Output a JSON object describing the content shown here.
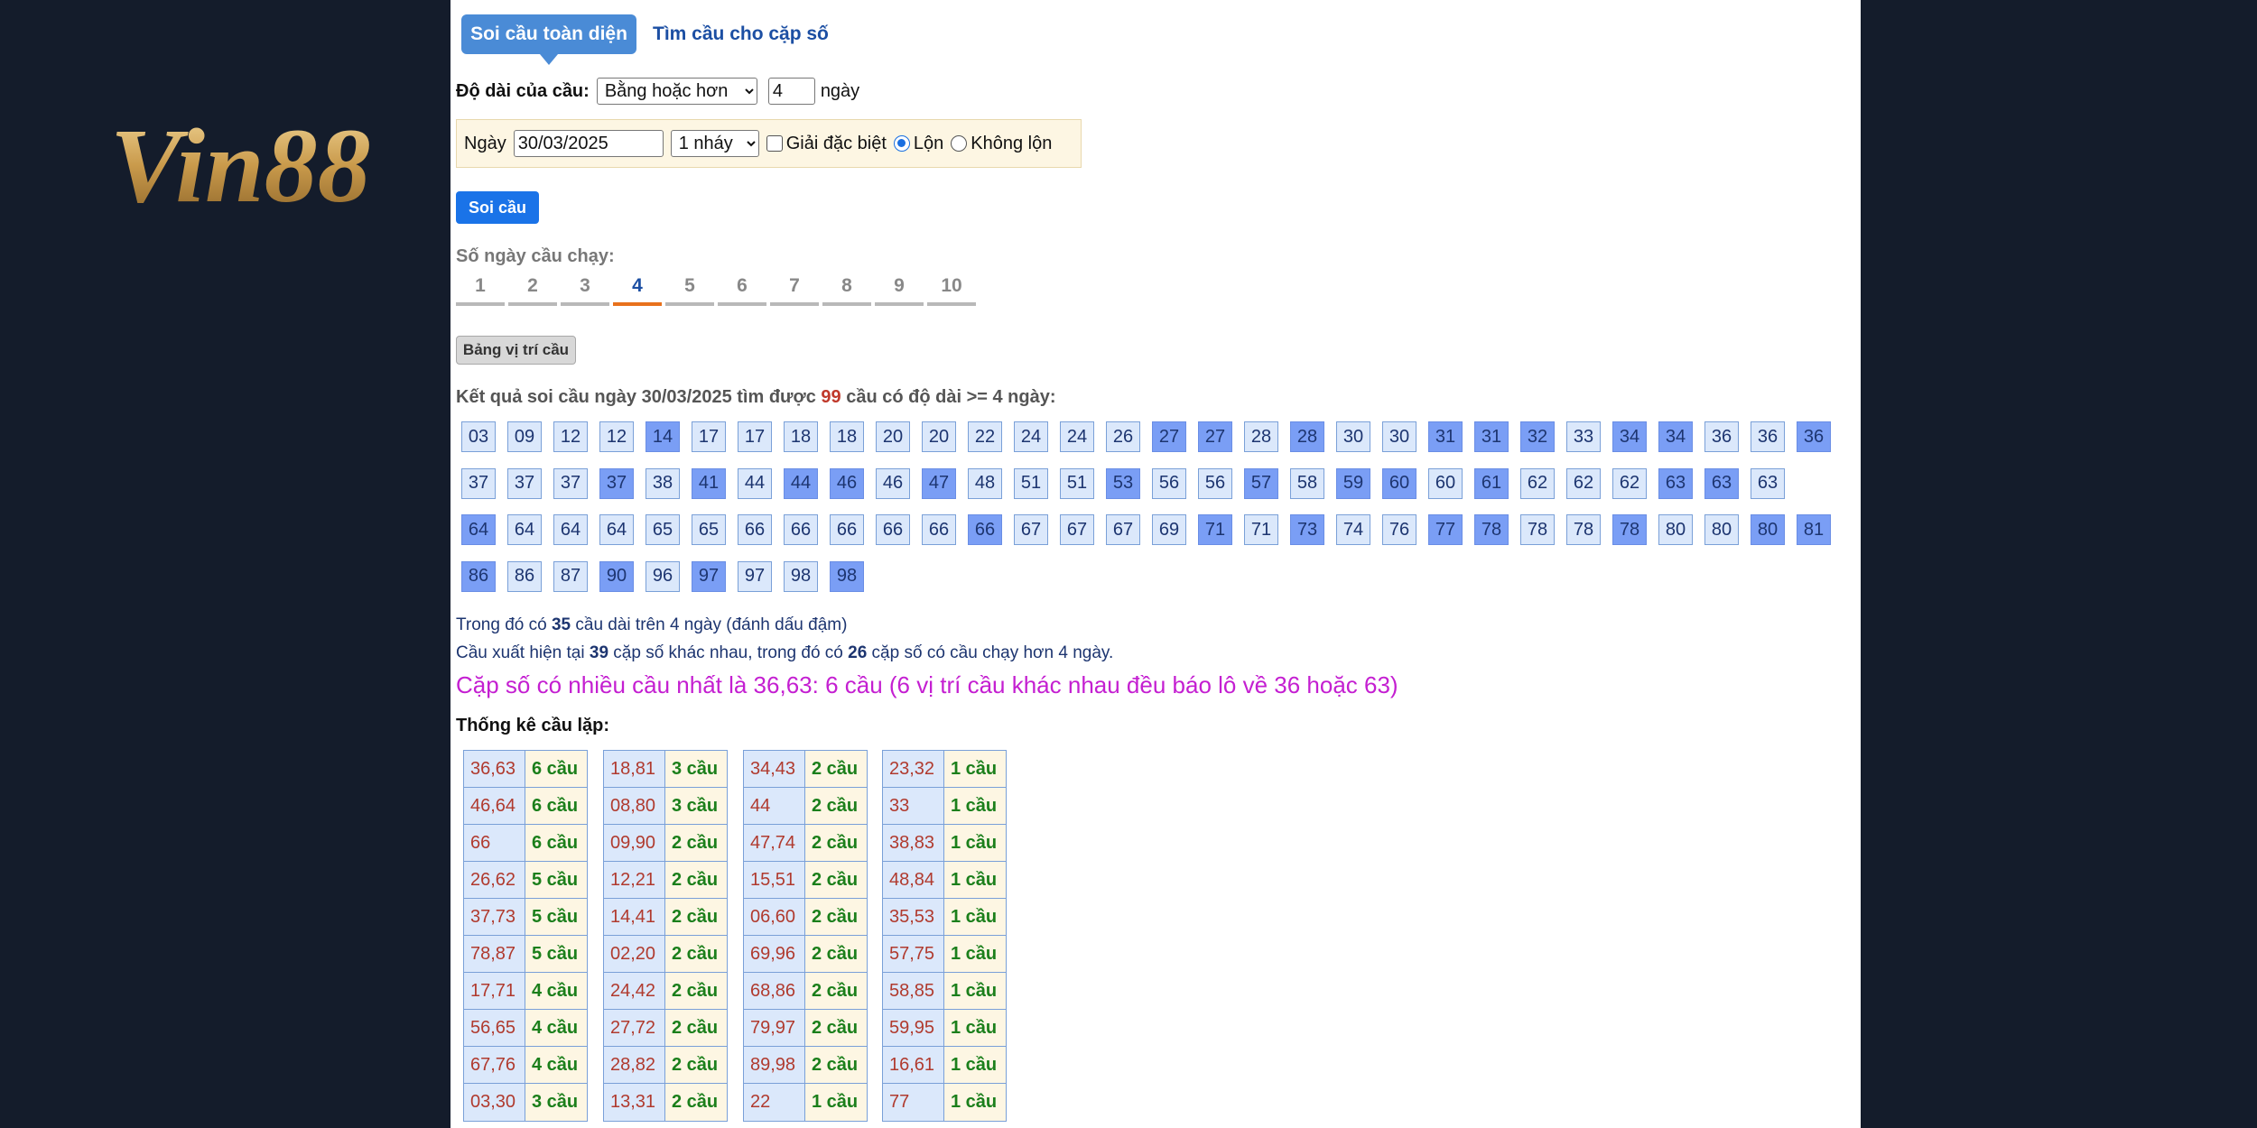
{
  "logo": {
    "text": "Vin88"
  },
  "tabs": {
    "active": "Soi cầu toàn diện",
    "other": "Tìm cầu cho cặp số"
  },
  "length": {
    "label": "Độ dài của cầu:",
    "mode": "Bằng hoặc hơn",
    "value": "4",
    "unit": "ngày"
  },
  "filter": {
    "date_label": "Ngày",
    "date": "30/03/2025",
    "nhay": "1 nháy",
    "special": "Giải đặc biệt",
    "lon": "Lộn",
    "khong_lon": "Không lộn"
  },
  "button_soi": "Soi cầu",
  "days": {
    "label": "Số ngày cầu chạy:",
    "items": [
      "1",
      "2",
      "3",
      "4",
      "5",
      "6",
      "7",
      "8",
      "9",
      "10"
    ],
    "active": "4"
  },
  "button_bang": "Bảng vị trí cầu",
  "result": {
    "prefix": "Kết quả soi cầu ngày 30/03/2025 tìm được ",
    "count": "99",
    "suffix": " cầu có độ dài >= 4 ngày:"
  },
  "numbers": [
    [
      "03",
      0
    ],
    [
      "09",
      0
    ],
    [
      "12",
      0
    ],
    [
      "12",
      0
    ],
    [
      "14",
      1
    ],
    [
      "17",
      0
    ],
    [
      "17",
      0
    ],
    [
      "18",
      0
    ],
    [
      "18",
      0
    ],
    [
      "20",
      0
    ],
    [
      "20",
      0
    ],
    [
      "22",
      0
    ],
    [
      "24",
      0
    ],
    [
      "24",
      0
    ],
    [
      "26",
      0
    ],
    [
      "27",
      1
    ],
    [
      "27",
      1
    ],
    [
      "28",
      0
    ],
    [
      "28",
      1
    ],
    [
      "30",
      0
    ],
    [
      "30",
      0
    ],
    [
      "31",
      1
    ],
    [
      "31",
      1
    ],
    [
      "32",
      1
    ],
    [
      "33",
      0
    ],
    [
      "34",
      1
    ],
    [
      "34",
      1
    ],
    [
      "36",
      0
    ],
    [
      "36",
      0
    ],
    [
      "36",
      1
    ],
    [
      "37",
      0
    ],
    [
      "37",
      0
    ],
    [
      "37",
      0
    ],
    [
      "37",
      1
    ],
    [
      "38",
      0
    ],
    [
      "41",
      1
    ],
    [
      "44",
      0
    ],
    [
      "44",
      1
    ],
    [
      "46",
      1
    ],
    [
      "46",
      0
    ],
    [
      "47",
      1
    ],
    [
      "48",
      0
    ],
    [
      "51",
      0
    ],
    [
      "51",
      0
    ],
    [
      "53",
      1
    ],
    [
      "56",
      0
    ],
    [
      "56",
      0
    ],
    [
      "57",
      1
    ],
    [
      "58",
      0
    ],
    [
      "59",
      1
    ],
    [
      "60",
      1
    ],
    [
      "60",
      0
    ],
    [
      "61",
      1
    ],
    [
      "62",
      0
    ],
    [
      "62",
      0
    ],
    [
      "62",
      0
    ],
    [
      "63",
      1
    ],
    [
      "63",
      1
    ],
    [
      "63",
      0
    ],
    [
      "64",
      1
    ],
    [
      "64",
      0
    ],
    [
      "64",
      0
    ],
    [
      "64",
      0
    ],
    [
      "65",
      0
    ],
    [
      "65",
      0
    ],
    [
      "66",
      0
    ],
    [
      "66",
      0
    ],
    [
      "66",
      0
    ],
    [
      "66",
      0
    ],
    [
      "66",
      0
    ],
    [
      "66",
      1
    ],
    [
      "67",
      0
    ],
    [
      "67",
      0
    ],
    [
      "67",
      0
    ],
    [
      "69",
      0
    ],
    [
      "71",
      1
    ],
    [
      "71",
      0
    ],
    [
      "73",
      1
    ],
    [
      "74",
      0
    ],
    [
      "76",
      0
    ],
    [
      "77",
      1
    ],
    [
      "78",
      1
    ],
    [
      "78",
      0
    ],
    [
      "78",
      0
    ],
    [
      "78",
      1
    ],
    [
      "80",
      0
    ],
    [
      "80",
      0
    ],
    [
      "80",
      1
    ],
    [
      "81",
      1
    ],
    [
      "86",
      1
    ],
    [
      "86",
      0
    ],
    [
      "87",
      0
    ],
    [
      "90",
      1
    ],
    [
      "96",
      0
    ],
    [
      "97",
      1
    ],
    [
      "97",
      0
    ],
    [
      "98",
      0
    ],
    [
      "98",
      1
    ]
  ],
  "info": {
    "line1_a": "Trong đó có ",
    "line1_n": "35",
    "line1_b": " cầu dài trên 4 ngày (đánh dấu đậm)",
    "line2_a": "Cầu xuất hiện tại ",
    "line2_n1": "39",
    "line2_b": " cặp số khác nhau, trong đó có ",
    "line2_n2": "26",
    "line2_c": " cặp số có cầu chạy hơn 4 ngày."
  },
  "best": "Cặp số có nhiều cầu nhất là 36,63: 6 cầu (6 vị trí cầu khác nhau đều báo lô về 36 hoặc 63)",
  "stats_title": "Thống kê cầu lặp:",
  "stats": [
    [
      [
        "36,63",
        "6 cầu"
      ],
      [
        "46,64",
        "6 cầu"
      ],
      [
        "66",
        "6 cầu"
      ],
      [
        "26,62",
        "5 cầu"
      ],
      [
        "37,73",
        "5 cầu"
      ],
      [
        "78,87",
        "5 cầu"
      ],
      [
        "17,71",
        "4 cầu"
      ],
      [
        "56,65",
        "4 cầu"
      ],
      [
        "67,76",
        "4 cầu"
      ],
      [
        "03,30",
        "3 cầu"
      ]
    ],
    [
      [
        "18,81",
        "3 cầu"
      ],
      [
        "08,80",
        "3 cầu"
      ],
      [
        "09,90",
        "2 cầu"
      ],
      [
        "12,21",
        "2 cầu"
      ],
      [
        "14,41",
        "2 cầu"
      ],
      [
        "02,20",
        "2 cầu"
      ],
      [
        "24,42",
        "2 cầu"
      ],
      [
        "27,72",
        "2 cầu"
      ],
      [
        "28,82",
        "2 cầu"
      ],
      [
        "13,31",
        "2 cầu"
      ]
    ],
    [
      [
        "34,43",
        "2 cầu"
      ],
      [
        "44",
        "2 cầu"
      ],
      [
        "47,74",
        "2 cầu"
      ],
      [
        "15,51",
        "2 cầu"
      ],
      [
        "06,60",
        "2 cầu"
      ],
      [
        "69,96",
        "2 cầu"
      ],
      [
        "68,86",
        "2 cầu"
      ],
      [
        "79,97",
        "2 cầu"
      ],
      [
        "89,98",
        "2 cầu"
      ],
      [
        "22",
        "1 cầu"
      ]
    ],
    [
      [
        "23,32",
        "1 cầu"
      ],
      [
        "33",
        "1 cầu"
      ],
      [
        "38,83",
        "1 cầu"
      ],
      [
        "48,84",
        "1 cầu"
      ],
      [
        "35,53",
        "1 cầu"
      ],
      [
        "57,75",
        "1 cầu"
      ],
      [
        "58,85",
        "1 cầu"
      ],
      [
        "59,95",
        "1 cầu"
      ],
      [
        "16,61",
        "1 cầu"
      ],
      [
        "77",
        "1 cầu"
      ]
    ]
  ]
}
